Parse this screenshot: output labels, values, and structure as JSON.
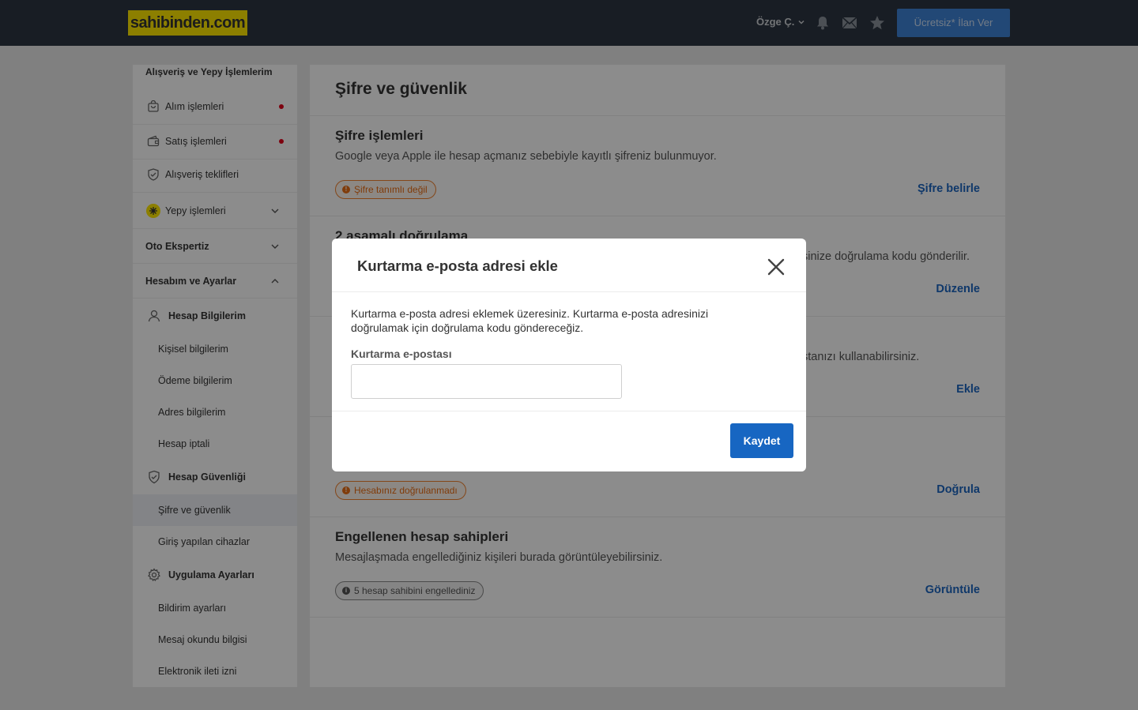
{
  "header": {
    "logo": "sahibinden.com",
    "user_name": "Özge Ç.",
    "post_button": "Ücretsiz* İlan Ver"
  },
  "sidebar": {
    "section1_title": "Alışveriş ve Yepy İşlemlerim",
    "items": [
      {
        "label": "Alım işlemleri"
      },
      {
        "label": "Satış işlemleri"
      },
      {
        "label": "Alışveriş teklifleri"
      },
      {
        "label": "Yepy işlemleri"
      }
    ],
    "oto_title": "Oto Ekspertiz",
    "account_title": "Hesabım ve Ayarlar",
    "groups": {
      "hesap_bilgilerim": "Hesap Bilgilerim",
      "hesap_guvenligi": "Hesap Güvenliği",
      "uygulama_ayarlari": "Uygulama Ayarları"
    },
    "sub_items": {
      "kisisel": "Kişisel bilgilerim",
      "odeme": "Ödeme bilgilerim",
      "adres": "Adres bilgilerim",
      "iptal": "Hesap iptali",
      "sifre": "Şifre ve güvenlik",
      "cihazlar": "Giriş yapılan cihazlar",
      "bildirim": "Bildirim ayarları",
      "mesaj": "Mesaj okundu bilgisi",
      "elektronik": "Elektronik ileti izni"
    }
  },
  "main": {
    "title": "Şifre ve güvenlik",
    "sections": [
      {
        "title": "Şifre işlemleri",
        "description": "Google veya Apple ile hesap açmanız sebebiyle kayıtlı şifreniz bulunmuyor.",
        "badge": "Şifre tanımlı değil",
        "action": "Şifre belirle"
      },
      {
        "title": "2 aşamalı doğrulama",
        "description_partial": "sinize doğrulama kodu gönderilir.",
        "action": "Düzenle"
      },
      {
        "description_partial": "stanızı kullanabilirsiniz.",
        "action": "Ekle"
      },
      {
        "badge": "Hesabınız doğrulanmadı",
        "action": "Doğrula"
      },
      {
        "title": "Engellenen hesap sahipleri",
        "description": "Mesajlaşmada engellediğiniz kişileri burada görüntüleyebilirsiniz.",
        "badge": "5 hesap sahibini engellediniz",
        "action": "Görüntüle"
      }
    ]
  },
  "modal": {
    "title": "Kurtarma e-posta adresi ekle",
    "text": "Kurtarma e-posta adresi eklemek üzeresiniz. Kurtarma e-posta adresinizi doğrulamak için doğrulama kodu göndereceğiz.",
    "field_label": "Kurtarma e-postası",
    "field_value": "",
    "save_label": "Kaydet"
  },
  "colors": {
    "header_bg": "#2d3642",
    "logo_bg": "#ffe800",
    "link_blue": "#1d66c2",
    "button_blue": "#1766c2",
    "warning_orange": "#e96d13"
  }
}
